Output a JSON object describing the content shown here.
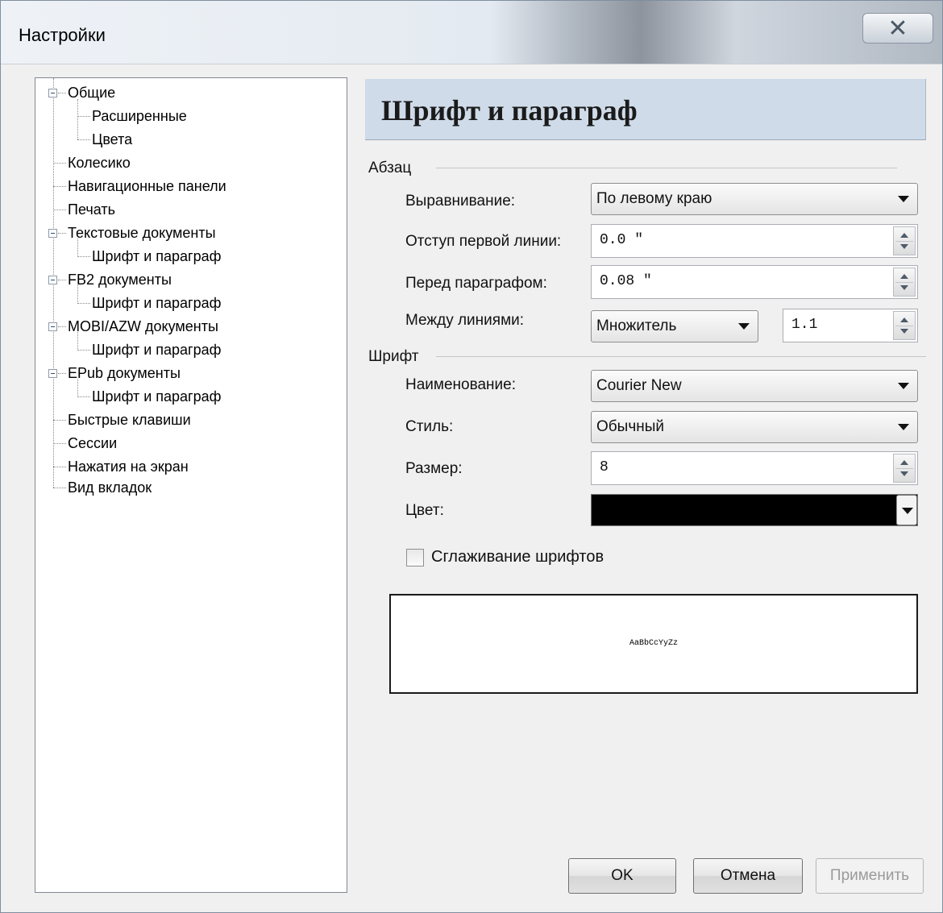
{
  "window": {
    "title": "Настройки",
    "close_icon": "✕"
  },
  "tree": {
    "items": [
      {
        "label": "Общие"
      },
      {
        "label": "Расширенные"
      },
      {
        "label": "Цвета"
      },
      {
        "label": "Колесико"
      },
      {
        "label": "Навигационные панели"
      },
      {
        "label": "Печать"
      },
      {
        "label": "Текстовые документы"
      },
      {
        "label": "Шрифт и параграф"
      },
      {
        "label": "FB2 документы"
      },
      {
        "label": "Шрифт и параграф"
      },
      {
        "label": "MOBI/AZW документы"
      },
      {
        "label": "Шрифт и параграф"
      },
      {
        "label": "EPub документы"
      },
      {
        "label": "Шрифт и параграф"
      },
      {
        "label": "Быстрые клавиши"
      },
      {
        "label": "Сессии"
      },
      {
        "label": "Нажатия на экран"
      },
      {
        "label": "Вид вкладок"
      }
    ]
  },
  "page": {
    "title": "Шрифт и параграф",
    "paragraph_group": "Абзац",
    "font_group": "Шрифт"
  },
  "paragraph": {
    "alignment_label": "Выравнивание:",
    "alignment_value": "По левому краю",
    "first_indent_label": "Отступ первой линии:",
    "first_indent_value": "0.0 \"",
    "before_label": "Перед параграфом:",
    "before_value": "0.08 \"",
    "line_spacing_label": "Между линиями:",
    "line_spacing_mode": "Множитель",
    "line_spacing_value": "1.1"
  },
  "font": {
    "name_label": "Наименование:",
    "name_value": "Courier New",
    "style_label": "Стиль:",
    "style_value": "Обычный",
    "size_label": "Размер:",
    "size_value": "8",
    "color_label": "Цвет:",
    "color_value": "#000000",
    "antialias_label": "Сглаживание шрифтов",
    "antialias_checked": false,
    "preview_text": "AaBbCcYyZz"
  },
  "buttons": {
    "ok": "OK",
    "cancel": "Отмена",
    "apply": "Применить"
  }
}
